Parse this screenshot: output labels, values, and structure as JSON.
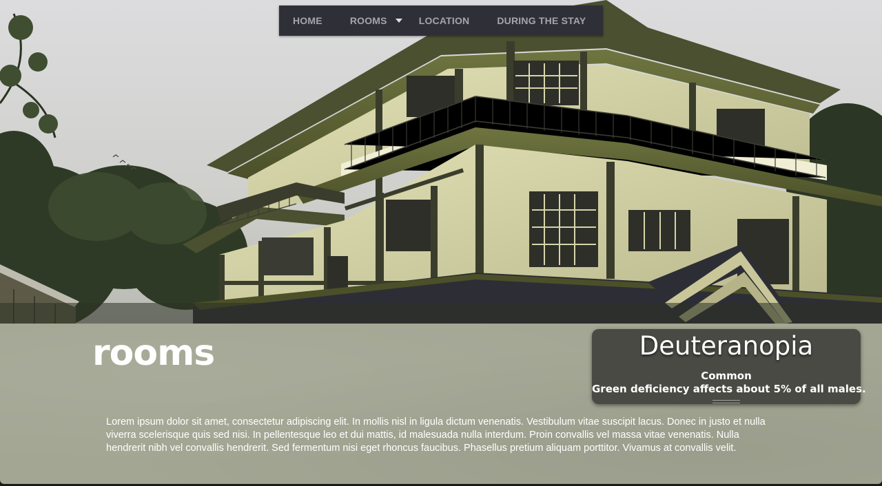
{
  "nav": {
    "items": [
      {
        "label": "HOME"
      },
      {
        "label": "ROOMS"
      },
      {
        "label": "LOCATION"
      },
      {
        "label": "DURING THE STAY"
      }
    ]
  },
  "section": {
    "title": "rooms",
    "body": "Lorem ipsum dolor sit amet, consectetur adipiscing elit. In mollis nisl in ligula dictum venenatis. Vestibulum vitae suscipit lacus. Donec in justo et nulla viverra scelerisque quis sed nisi. In pellentesque leo et dui mattis, id malesuada nulla interdum. Proin convallis vel massa vitae venenatis. Nulla hendrerit nibh vel convallis hendrerit. Sed fermentum nisi eget rhoncus faucibus. Phasellus pretium aliquam porttitor. Vivamus at convallis velit."
  },
  "simulation_card": {
    "title": "Deuteranopia",
    "prevalence": "Common",
    "description": "Green deficiency affects about 5% of all males."
  },
  "colors": {
    "nav_bg": "#2f2f37",
    "nav_text": "#a5a5ad",
    "panel_bg": "#a3a693",
    "card_bg": "#4a4a44"
  }
}
